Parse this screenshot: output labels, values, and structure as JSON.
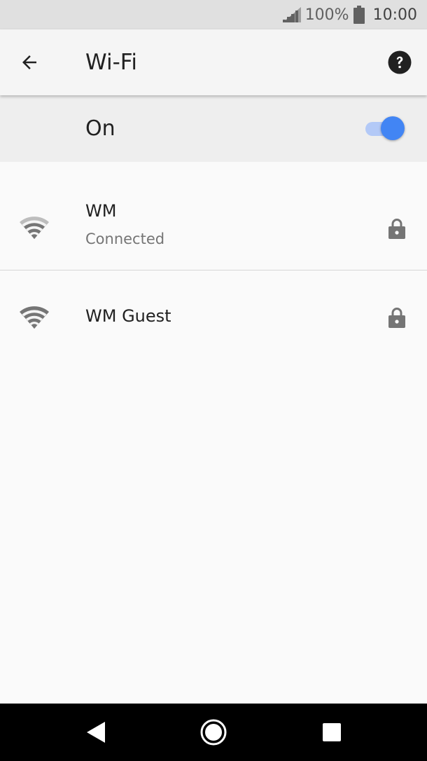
{
  "status_bar": {
    "battery_text": "100%",
    "time": "10:00"
  },
  "app_bar": {
    "title": "Wi-Fi"
  },
  "master_switch": {
    "label": "On",
    "state": "on",
    "accent_color": "#4285f4"
  },
  "networks": [
    {
      "name": "WM",
      "status": "Connected",
      "secured": true,
      "icon": "wifi-signal-icon"
    },
    {
      "name": "WM Guest",
      "status": "",
      "secured": true,
      "icon": "wifi-signal-icon"
    }
  ],
  "nav_bar": {
    "icons": [
      "back-triangle-icon",
      "home-circle-icon",
      "recents-square-icon"
    ]
  }
}
